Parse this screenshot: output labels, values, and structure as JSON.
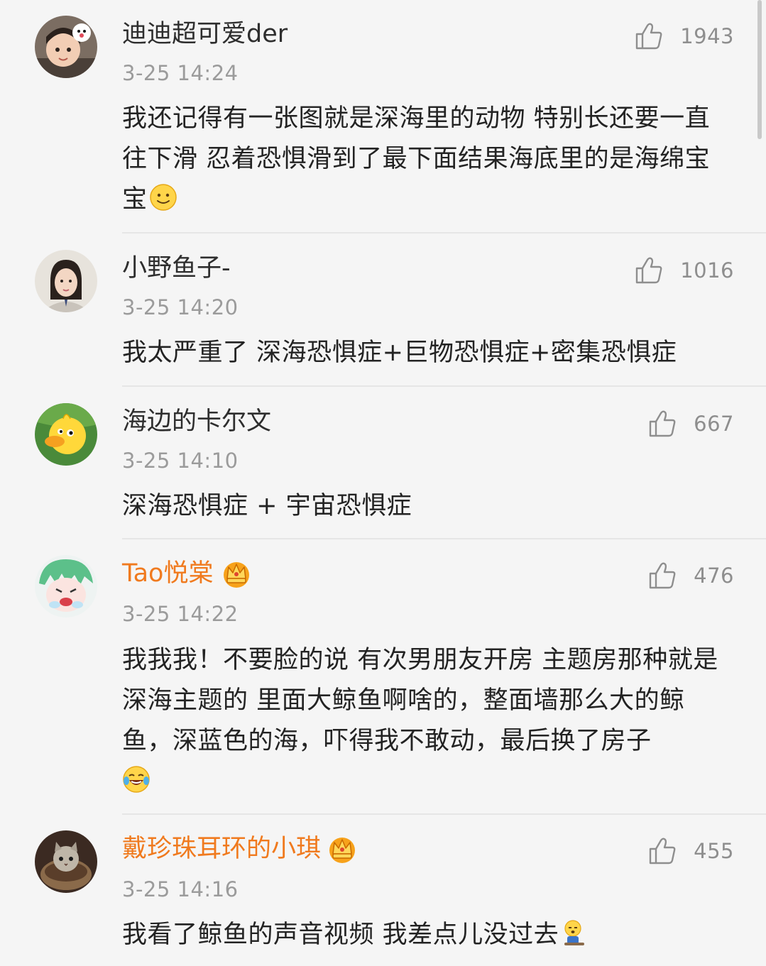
{
  "comments": [
    {
      "username": "迪迪超可爱der",
      "time": "3-25 14:24",
      "likes": "1943",
      "text": "我还记得有一张图就是深海里的动物 特别长还要一直往下滑 忍着恐惧滑到了最下面结果海底里的是海绵宝宝",
      "emoji": "smile-emoji"
    },
    {
      "username": "小野鱼子-",
      "time": "3-25 14:20",
      "likes": "1016",
      "text": "我太严重了 深海恐惧症+巨物恐惧症+密集恐惧症"
    },
    {
      "username": "海边的卡尔文",
      "time": "3-25 14:10",
      "likes": "667",
      "text": "深海恐惧症 + 宇宙恐惧症"
    },
    {
      "username": "Tao悦棠",
      "time": "3-25 14:22",
      "likes": "476",
      "text": "我我我！不要脸的说 有次男朋友开房 主题房那种就是深海主题的 里面大鲸鱼啊啥的，整面墙那么大的鲸鱼，深蓝色的海，吓得我不敢动，最后换了房子",
      "emoji": "laughing-tears-emoji"
    },
    {
      "username": "戴珍珠耳环的小琪",
      "time": "3-25 14:16",
      "likes": "455",
      "text": "我看了鲸鱼的声音视频 我差点儿没过去",
      "emoji": "fainting-emoji"
    }
  ],
  "colors": {
    "background": "#f5f5f5",
    "vip_name": "#f07a1e",
    "meta_text": "#9b9b9b"
  }
}
